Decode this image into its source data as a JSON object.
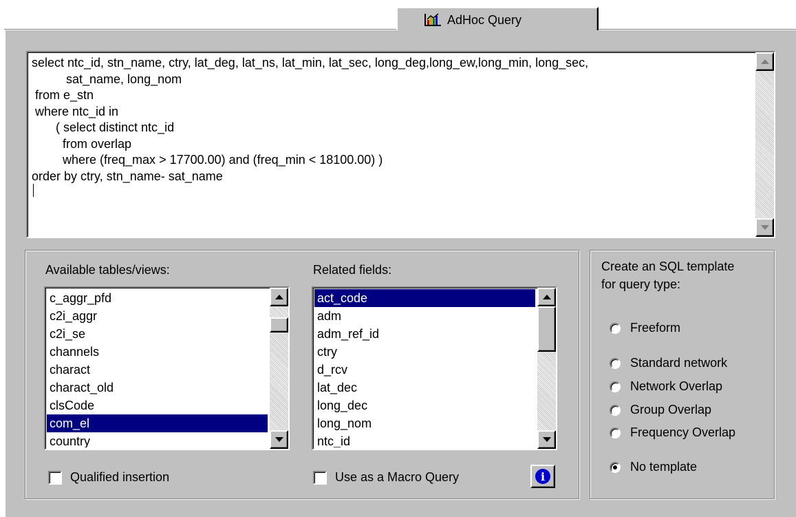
{
  "tab": {
    "label": "AdHoc Query",
    "icon": "query-chart-icon"
  },
  "editor": {
    "sql": "select ntc_id, stn_name, ctry, lat_deg, lat_ns, lat_min, lat_sec, long_deg,long_ew,long_min, long_sec,\n          sat_name, long_nom\n from e_stn\n where ntc_id in\n       ( select distinct ntc_id\n         from overlap\n         where (freq_max > 17700.00) and (freq_min < 18100.00) )\norder by ctry, stn_name- sat_name"
  },
  "tables": {
    "label": "Available tables/views:",
    "items": [
      "c_aggr_pfd",
      "c2i_aggr",
      "c2i_se",
      "channels",
      "charact",
      "charact_old",
      "clsCode",
      "com_el",
      "country"
    ],
    "selected": "com_el"
  },
  "fields": {
    "label": "Related fields:",
    "items": [
      "act_code",
      "adm",
      "adm_ref_id",
      "ctry",
      "d_rcv",
      "lat_dec",
      "long_dec",
      "long_nom",
      "ntc_id"
    ],
    "selected": "act_code"
  },
  "options": {
    "qualified_insertion": {
      "label": "Qualified insertion",
      "checked": false
    },
    "macro_query": {
      "label": "Use as a Macro Query",
      "checked": false
    },
    "info_icon": "info-icon"
  },
  "template": {
    "title_line1": "Create an SQL template",
    "title_line2": "for query type:",
    "options": [
      {
        "label": "Freeform",
        "checked": false
      },
      {
        "label": "Standard network",
        "checked": false
      },
      {
        "label": "Network Overlap",
        "checked": false
      },
      {
        "label": "Group Overlap",
        "checked": false
      },
      {
        "label": "Frequency Overlap",
        "checked": false
      },
      {
        "label": "No template",
        "checked": true
      }
    ]
  },
  "colors": {
    "face": "#c0c0c0",
    "selection": "#000080",
    "info_blue": "#0000cc"
  }
}
